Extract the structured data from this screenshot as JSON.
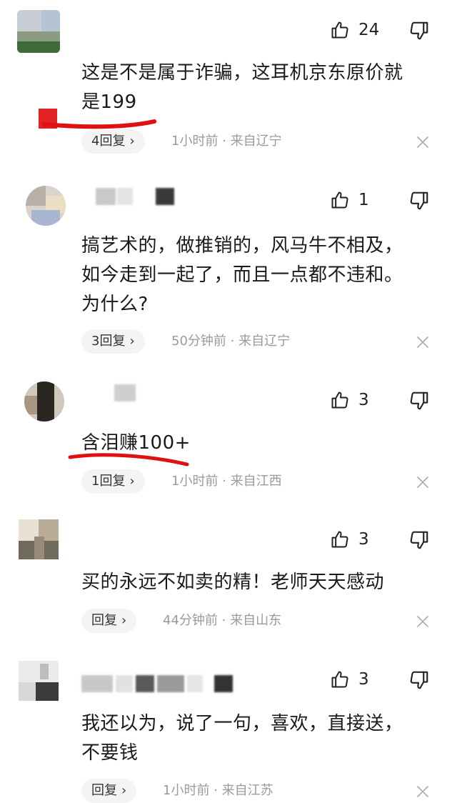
{
  "comments": [
    {
      "likes": "24",
      "lines": [
        "这是不是属于诈骗，这耳机京东原价就",
        "是199"
      ],
      "reply_label": "4回复",
      "time": "1小时前",
      "sep": "·",
      "location": "来自辽宁"
    },
    {
      "likes": "1",
      "lines": [
        "搞艺术的，做推销的，风马牛不相及，",
        "如今走到一起了，而且一点都不违和。",
        "为什么?"
      ],
      "reply_label": "3回复",
      "time": "50分钟前",
      "sep": "·",
      "location": "来自辽宁"
    },
    {
      "likes": "3",
      "lines": [
        "含泪赚100+"
      ],
      "reply_label": "1回复",
      "time": "1小时前",
      "sep": "·",
      "location": "来自江西"
    },
    {
      "likes": "3",
      "lines": [
        "买的永远不如卖的精！老师天天感动"
      ],
      "reply_label": "回复",
      "time": "44分钟前",
      "sep": "·",
      "location": "来自山东"
    },
    {
      "likes": "3",
      "lines": [
        "我还以为，说了一句，喜欢，直接送，",
        "不要钱"
      ],
      "reply_label": "回复",
      "time": "1小时前",
      "sep": "·",
      "location": "来自江苏"
    }
  ],
  "chevron": "›",
  "icons": {
    "like": "thumbs-up-icon",
    "dislike": "thumbs-down-icon",
    "close": "close-icon"
  },
  "colors": {
    "annotation_underline": "#e01010",
    "meta_text": "#9a9a9a",
    "reply_pill": "#f4f4f4"
  }
}
